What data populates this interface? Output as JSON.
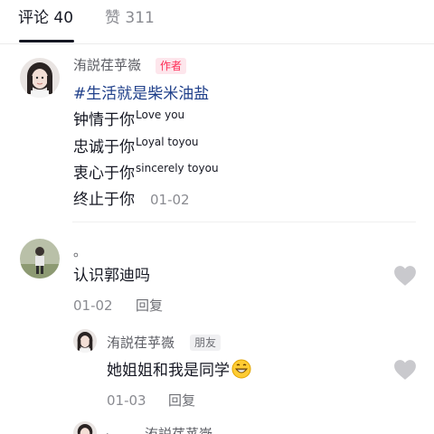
{
  "tabs": {
    "comments_label": "评论 40",
    "likes_label": "赞 311"
  },
  "comment1": {
    "username": "洧説荏苸嶶",
    "badge": "作者",
    "hashtag": "#生活就是柴米油盐",
    "line1_main": "钟情于你",
    "line1_sup": "Love you",
    "line2_main": "忠诚于你",
    "line2_sup": "Loyal toyou",
    "line3_main": "衷心于你",
    "line3_sup": "sincerely toyou",
    "line4_main": "终止于你",
    "date": "01-02"
  },
  "comment2": {
    "username": "。",
    "text": "认识郭迪吗",
    "date": "01-02",
    "reply_label": "回复"
  },
  "reply1": {
    "username": "洧説荏苸嶶",
    "badge": "朋友",
    "text": "她姐姐和我是同学",
    "emoji": "grinning-face-emoji",
    "date": "01-03",
    "reply_label": "回复"
  },
  "reply2": {
    "username": "洧説荏苸嶶"
  },
  "colors": {
    "author_badge": "#fe2c55",
    "hashtag": "#1f3f8a",
    "muted": "#8a8b91",
    "heart": "#c9c9cd"
  }
}
